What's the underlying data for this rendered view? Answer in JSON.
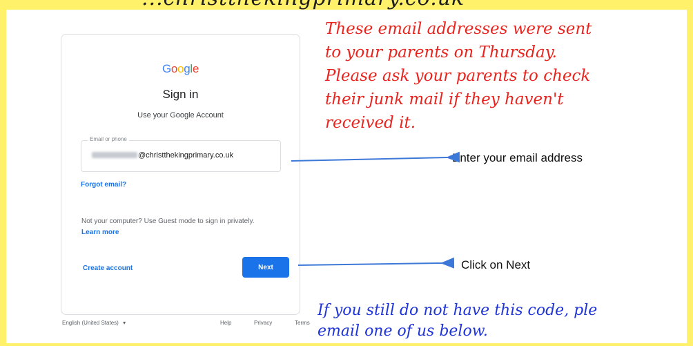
{
  "banner": {
    "partial_text": "...christthekingprimary.co.uk"
  },
  "signin": {
    "logo_letters": [
      "G",
      "o",
      "o",
      "g",
      "l",
      "e"
    ],
    "title": "Sign in",
    "subtitle": "Use your Google Account",
    "email_field": {
      "label": "Email or phone",
      "domain_suffix": "@christthekingprimary.co.uk"
    },
    "forgot_email": "Forgot email?",
    "guest_text": "Not your computer? Use Guest mode to sign in privately.",
    "learn_more": "Learn more",
    "create_account": "Create account",
    "next_label": "Next"
  },
  "footer": {
    "language": "English (United States)",
    "help": "Help",
    "privacy": "Privacy",
    "terms": "Terms"
  },
  "annotations": {
    "red_note": [
      "These email addresses were sent",
      "to your parents on Thursday.",
      "Please ask your parents to check",
      "their junk mail if they haven't",
      "received it."
    ],
    "enter_email": "Enter your email address",
    "click_next": "Click on Next",
    "blue_note": [
      "If you still do not have this code, ple",
      "email one of us below."
    ]
  },
  "colors": {
    "google_blue": "#1a73e8",
    "note_red": "#e8241f",
    "note_blue": "#1f35d8",
    "frame_yellow": "#fff16a",
    "arrow_blue": "#3c78d8"
  },
  "icons": {
    "language_dropdown": "caret-down-icon",
    "annotation_arrows": "arrow-left-icon"
  }
}
